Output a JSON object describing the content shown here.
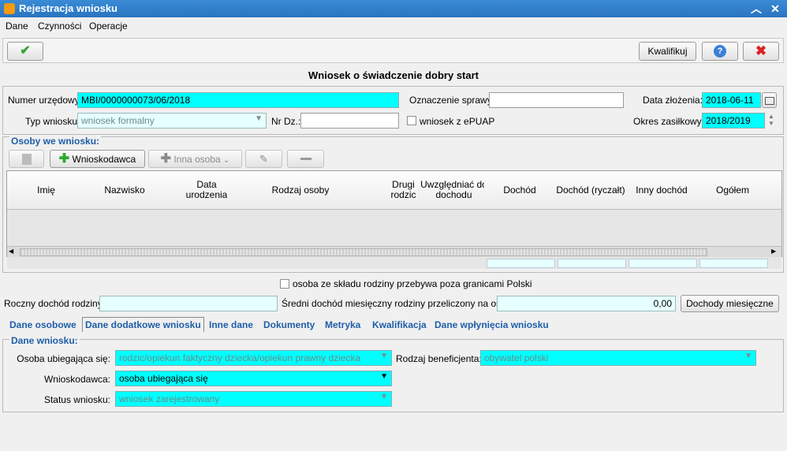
{
  "window": {
    "title": "Rejestracja wniosku"
  },
  "menu": [
    "Dane",
    "Czynności",
    "Operacje"
  ],
  "toolbar": {
    "qualify_label": "Kwalifikuj"
  },
  "form_title": "Wniosek o świadczenie dobry start",
  "fields": {
    "numer_label": "Numer urzędowy:",
    "numer_value": "MBI/0000000073/06/2018",
    "oznaczenie_label": "Oznaczenie sprawy:",
    "oznaczenie_value": "",
    "data_label": "Data złożenia:",
    "data_value": "2018-06-11",
    "typ_label": "Typ wniosku:",
    "typ_value": "wniosek formalny",
    "nrdz_label": "Nr Dz.:",
    "nrdz_value": "",
    "epuap_label": "wniosek z ePUAP",
    "okres_label": "Okres zasiłkowy:",
    "okres_value": "2018/2019"
  },
  "persons": {
    "section_title": "Osoby we wniosku:",
    "add_applicant": "Wnioskodawca",
    "add_other": "Inna osoba",
    "columns": [
      "Imię",
      "Nazwisko",
      "Data urodzenia",
      "Rodzaj osoby",
      "Drugi rodzic",
      "Uwzględniać do dochodu",
      "Dochód",
      "Dochód (ryczałt)",
      "Inny dochód",
      "Ogółem"
    ]
  },
  "abroad_label": "osoba ze składu rodziny przebywa poza granicami Polski",
  "income": {
    "annual_label": "Roczny dochód rodziny:",
    "annual_value": "",
    "avg_label": "Średni dochód miesięczny rodziny przeliczony na osobę:",
    "avg_value": "0,00",
    "monthly_button": "Dochody miesięczne"
  },
  "tabs": [
    "Dane osobowe",
    "Dane dodatkowe wniosku",
    "Inne dane",
    "Dokumenty",
    "Metryka",
    "Kwalifikacja",
    "Dane wpłynięcia wniosku"
  ],
  "details": {
    "section_title": "Dane wniosku:",
    "osoba_label": "Osoba ubiegająca się:",
    "osoba_value": "rodzic/opiekun faktyczny dziecka/opiekun prawny dziecka",
    "rodzaj_label": "Rodzaj beneficjenta:",
    "rodzaj_value": "obywatel polski",
    "wnioskodawca_label": "Wnioskodawca:",
    "wnioskodawca_value": "osoba ubiegająca się",
    "status_label": "Status wniosku:",
    "status_value": "wniosek zarejestrowany"
  }
}
